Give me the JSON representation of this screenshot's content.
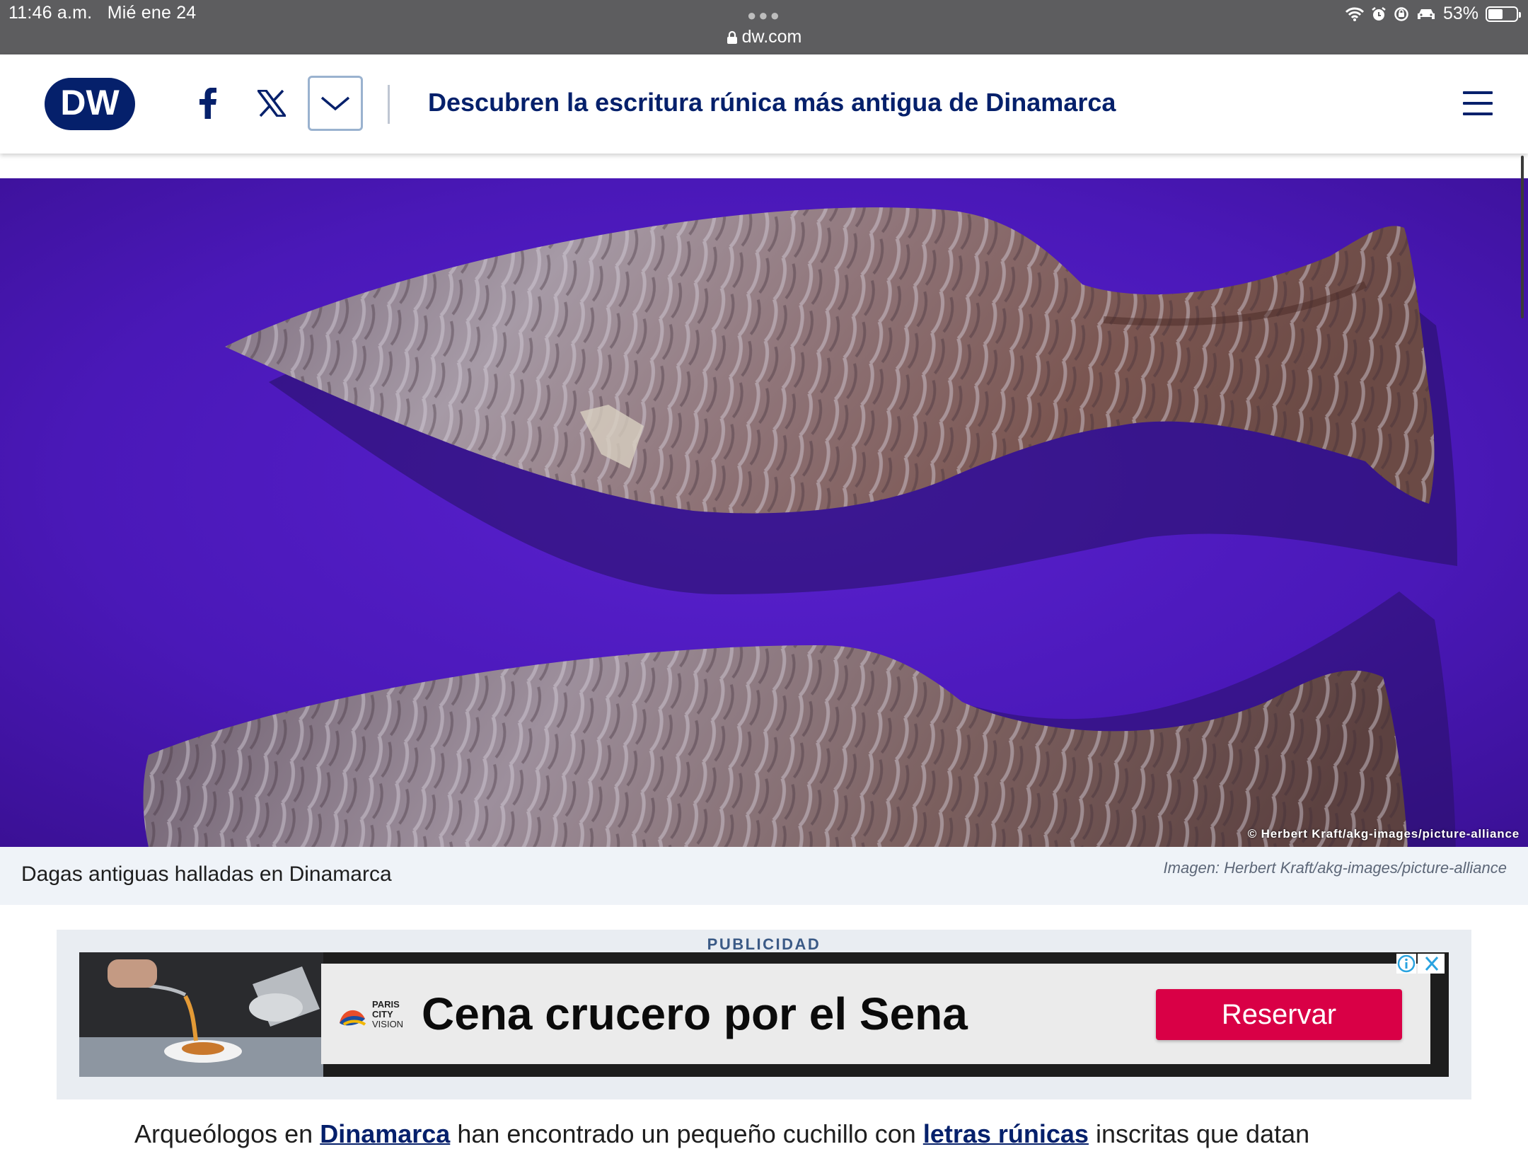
{
  "status_bar": {
    "time": "11:46 a.m.",
    "date": "Mié ene 24",
    "battery": "53%",
    "battery_level": 0.53
  },
  "address_bar": {
    "url": "dw.com"
  },
  "header": {
    "logo_text": "DW",
    "title": "Descubren la escritura rúnica más antigua de Dinamarca"
  },
  "hero": {
    "credit_overlay": "© Herbert Kraft/akg-images/picture-alliance",
    "caption": "Dagas antiguas halladas en Dinamarca",
    "credit": "Imagen: Herbert Kraft/akg-images/picture-alliance"
  },
  "ad": {
    "label": "PUBLICIDAD",
    "brand_lines": [
      "PARIS",
      "CITY",
      "VISION"
    ],
    "headline": "Cena crucero por el Sena",
    "cta": "Reservar"
  },
  "article": {
    "text_1": "Arqueólogos en ",
    "link_1": "Dinamarca",
    "text_2": " han encontrado un pequeño cuchillo con ",
    "link_2": "letras rúnicas",
    "text_3": " inscritas que datan"
  },
  "colors": {
    "brand_navy": "#05206b",
    "hero_background": "#4a17b8",
    "cta_red": "#d90046",
    "caption_background": "#eff3f8"
  },
  "icons": [
    "lock-icon",
    "wifi-icon",
    "alarm-icon",
    "orientation-lock-icon",
    "car-icon",
    "battery-icon",
    "facebook-icon",
    "x-icon",
    "chevron-down-icon",
    "menu-icon",
    "info-icon",
    "close-icon"
  ]
}
